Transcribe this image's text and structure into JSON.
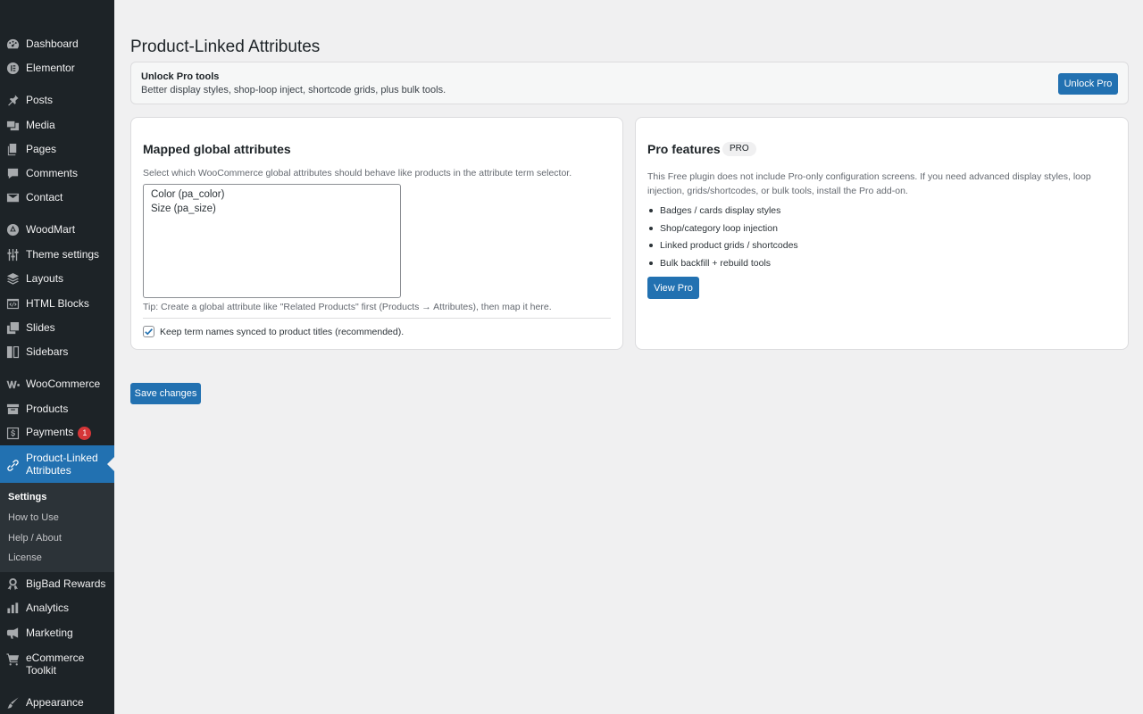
{
  "sidebar": {
    "items": [
      {
        "label": "Dashboard",
        "icon": "dashboard-icon"
      },
      {
        "label": "Elementor",
        "icon": "elementor-icon"
      },
      {
        "label": "Posts",
        "icon": "pin-icon"
      },
      {
        "label": "Media",
        "icon": "media-icon"
      },
      {
        "label": "Pages",
        "icon": "pages-icon"
      },
      {
        "label": "Comments",
        "icon": "comment-icon"
      },
      {
        "label": "Contact",
        "icon": "mail-icon"
      },
      {
        "label": "WoodMart",
        "icon": "woodmart-icon"
      },
      {
        "label": "Theme settings",
        "icon": "sliders-icon"
      },
      {
        "label": "Layouts",
        "icon": "layers-icon"
      },
      {
        "label": "HTML Blocks",
        "icon": "html-block-icon"
      },
      {
        "label": "Slides",
        "icon": "slides-icon"
      },
      {
        "label": "Sidebars",
        "icon": "sidebar-icon"
      },
      {
        "label": "WooCommerce",
        "icon": "woocommerce-icon"
      },
      {
        "label": "Products",
        "icon": "archive-icon"
      },
      {
        "label": "Payments",
        "icon": "payment-icon",
        "badge": "1"
      },
      {
        "label": "Product-Linked Attributes",
        "icon": "link-icon",
        "active": true
      },
      {
        "label": "BigBad Rewards",
        "icon": "award-icon"
      },
      {
        "label": "Analytics",
        "icon": "bar-chart-icon"
      },
      {
        "label": "Marketing",
        "icon": "megaphone-icon"
      },
      {
        "label": "eCommerce Toolkit",
        "icon": "cart-icon"
      },
      {
        "label": "Appearance",
        "icon": "brush-icon"
      }
    ],
    "submenu": [
      "Settings",
      "How to Use",
      "Help / About",
      "License"
    ]
  },
  "page": {
    "title": "Product-Linked Attributes"
  },
  "banner": {
    "title": "Unlock Pro tools",
    "description": "Better display styles, shop-loop inject, shortcode grids, plus bulk tools.",
    "button_label": "Unlock Pro"
  },
  "mapped": {
    "title": "Mapped global attributes",
    "description": "Select which WooCommerce global attributes should behave like products in the attribute term selector.",
    "options": [
      "Color (pa_color)",
      "Size (pa_size)"
    ],
    "tip": "Tip: Create a global attribute like \"Related Products\" first (Products → Attributes), then map it here.",
    "sync_label": "Keep term names synced to product titles (recommended).",
    "sync_checked": true
  },
  "pro": {
    "title": "Pro features",
    "badge": "PRO",
    "description": "This Free plugin does not include Pro-only configuration screens. If you need advanced display styles, loop injection, grids/shortcodes, or bulk tools, install the Pro add-on.",
    "features": [
      "Badges / cards display styles",
      "Shop/category loop injection",
      "Linked product grids / shortcodes",
      "Bulk backfill + rebuild tools"
    ],
    "button_label": "View Pro"
  },
  "footer": {
    "save_label": "Save changes"
  },
  "colors": {
    "sidebar_bg": "#1d2327",
    "accent": "#2271b1",
    "page_bg": "#f0f0f1",
    "badge": "#d63638"
  }
}
